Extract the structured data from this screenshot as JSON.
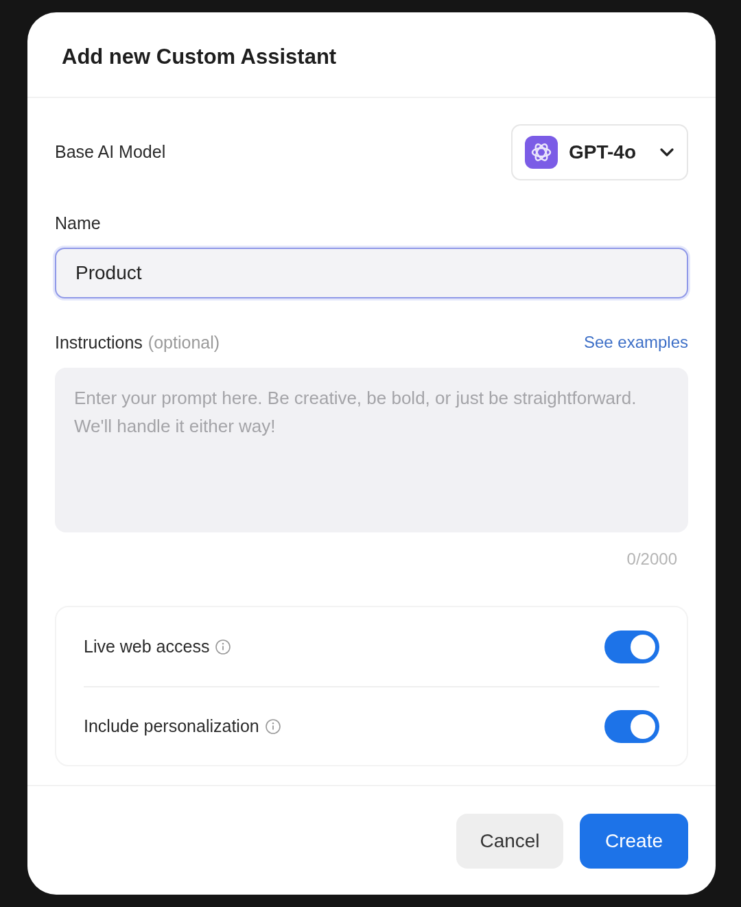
{
  "dialog": {
    "title": "Add new Custom Assistant"
  },
  "model": {
    "label": "Base AI Model",
    "value": "GPT-4o"
  },
  "name": {
    "label": "Name",
    "value": "Product"
  },
  "instructions": {
    "label": "Instructions",
    "hint": "(optional)",
    "link": "See examples",
    "placeholder": "Enter your prompt here. Be creative, be bold, or just be straightforward. We'll handle it either way!",
    "counter": "0/2000"
  },
  "settings": [
    {
      "label": "Live web access",
      "on": true
    },
    {
      "label": "Include personalization",
      "on": true
    }
  ],
  "buttons": [
    {
      "label": "Cancel",
      "kind": "secondary"
    },
    {
      "label": "Create",
      "kind": "primary"
    }
  ]
}
